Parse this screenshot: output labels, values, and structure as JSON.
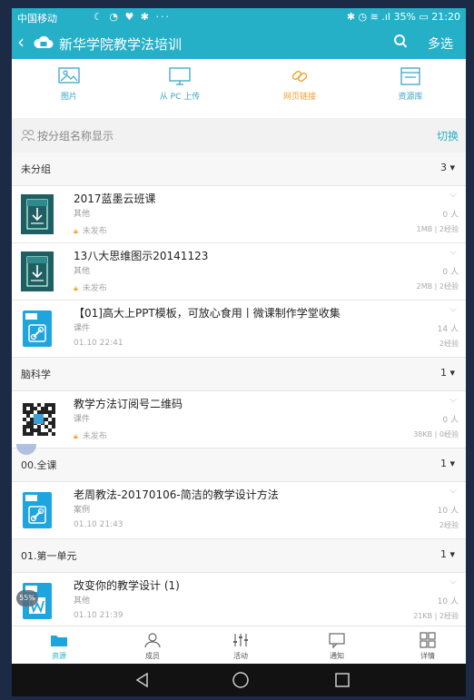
{
  "status_bar": {
    "carrier": "中国移动",
    "icons": "☾ ◔ ♥ ✱ ···",
    "right": "✱ ◷ ≋ .ıl 35% ▭ 21:20"
  },
  "header": {
    "back": "‹",
    "title": "新华学院教学法培训",
    "multi_select": "多选"
  },
  "toolbar": [
    {
      "label": "图片",
      "icon": "image-icon"
    },
    {
      "label": "从 PC 上传",
      "icon": "monitor-icon"
    },
    {
      "label": "网页链接",
      "icon": "link-icon",
      "active": true
    },
    {
      "label": "资源库",
      "icon": "library-icon"
    }
  ],
  "group_bar": {
    "label": "按分组名称显示",
    "switch": "切换"
  },
  "sections": [
    {
      "name": "未分组",
      "count": "3 ▾",
      "items": [
        {
          "title": "2017蓝墨云班课",
          "category": "其他",
          "status": "未发布",
          "locked": true,
          "people": "0 人",
          "size": "1MB | 2经验",
          "thumb": "pdf"
        },
        {
          "title": "13八大思维图示20141123",
          "category": "其他",
          "status": "未发布",
          "locked": true,
          "people": "0 人",
          "size": "2MB | 2经验",
          "thumb": "pdf"
        },
        {
          "title": "【01]高大上PPT模板，可放心食用丨微课制作学堂收集",
          "category": "课件",
          "status": "01.10 22:41",
          "locked": false,
          "people": "14 人",
          "size": "2经验",
          "thumb": "link"
        }
      ]
    },
    {
      "name": "脑科学",
      "count": "1 ▾",
      "items": [
        {
          "title": "教学方法订阅号二维码",
          "category": "课件",
          "status": "未发布",
          "locked": true,
          "people": "0 人",
          "size": "38KB | 0经验",
          "thumb": "qr"
        }
      ]
    },
    {
      "name": "00.全课",
      "count": "1 ▾",
      "items": [
        {
          "title": "老周教法-20170106-简洁的教学设计方法",
          "category": "案例",
          "status": "01.10 21:43",
          "locked": false,
          "people": "10 人",
          "size": "2经验",
          "thumb": "link"
        }
      ]
    },
    {
      "name": "01.第一单元",
      "count": "1 ▾",
      "items": [
        {
          "title": "改变你的教学设计 (1)",
          "category": "其他",
          "status": "01.10 21:39",
          "locked": false,
          "people": "10 人",
          "size": "21KB | 2经验",
          "thumb": "word"
        }
      ]
    }
  ],
  "bottom_nav": [
    {
      "label": "资源",
      "icon": "folder-icon",
      "active": true
    },
    {
      "label": "成员",
      "icon": "members-icon"
    },
    {
      "label": "活动",
      "icon": "activity-icon"
    },
    {
      "label": "通知",
      "icon": "notification-icon"
    },
    {
      "label": "详情",
      "icon": "details-icon"
    }
  ],
  "floating_badge": "55%",
  "colors": {
    "accent": "#26b0c8",
    "orange": "#f0a030",
    "dark_thumb": "#1f5f63"
  }
}
